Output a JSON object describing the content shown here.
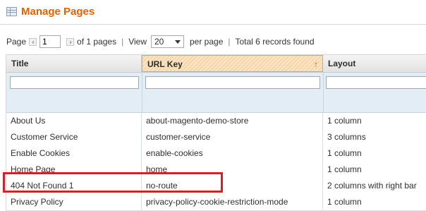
{
  "header": {
    "title": "Manage Pages",
    "icon": "grid-icon"
  },
  "pager": {
    "page_label": "Page",
    "page_value": "1",
    "of_pages": "of 1 pages",
    "view_label": "View",
    "per_page_value": "20",
    "per_page_label": "per page",
    "total": "Total 6 records found"
  },
  "grid": {
    "columns": [
      {
        "label": "Title"
      },
      {
        "label": "URL Key",
        "sorted": true,
        "sort_icon": "↑"
      },
      {
        "label": "Layout"
      }
    ],
    "rows": [
      {
        "title": "About Us",
        "url_key": "about-magento-demo-store",
        "layout": "1 column"
      },
      {
        "title": "Customer Service",
        "url_key": "customer-service",
        "layout": "3 columns"
      },
      {
        "title": "Enable Cookies",
        "url_key": "enable-cookies",
        "layout": "1 column"
      },
      {
        "title": "Home Page",
        "url_key": "home",
        "layout": "1 column"
      },
      {
        "title": "404 Not Found 1",
        "url_key": "no-route",
        "layout": "2 columns with right bar",
        "highlighted": true
      },
      {
        "title": "Privacy Policy",
        "url_key": "privacy-policy-cookie-restriction-mode",
        "layout": "1 column"
      }
    ]
  },
  "colors": {
    "title_orange": "#eb5e00",
    "highlight_red": "#d62027",
    "filter_bg": "#e3edf5"
  }
}
